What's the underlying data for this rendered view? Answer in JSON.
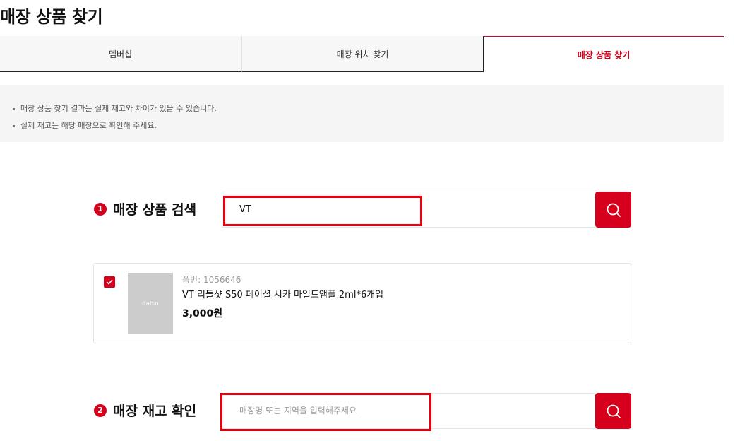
{
  "page": {
    "title": "매장 상품 찾기"
  },
  "tabs": [
    {
      "label": "멤버십"
    },
    {
      "label": "매장 위치 찾기"
    },
    {
      "label": "매장 상품 찾기"
    }
  ],
  "notice": [
    "매장 상품 찾기 결과는 실제 재고와 차이가 있을 수 있습니다.",
    "실제 재고는 해당 매장으로 확인해 주세요."
  ],
  "step1": {
    "number": "1",
    "label": "매장 상품 검색",
    "search_value": "VT",
    "search_icon": "search-icon"
  },
  "product": {
    "checked": true,
    "thumb_text": "daiso",
    "code": "품번: 1056646",
    "name": "VT 리들샷 S50 페이셜 시카 마일드앰플 2ml*6개입",
    "price": "3,000원"
  },
  "step2": {
    "number": "2",
    "label": "매장 재고 확인",
    "placeholder": "매장명 또는 지역을 입력해주세요",
    "search_icon": "search-icon"
  },
  "colors": {
    "accent": "#d6001c",
    "highlight": "#e8000f"
  }
}
